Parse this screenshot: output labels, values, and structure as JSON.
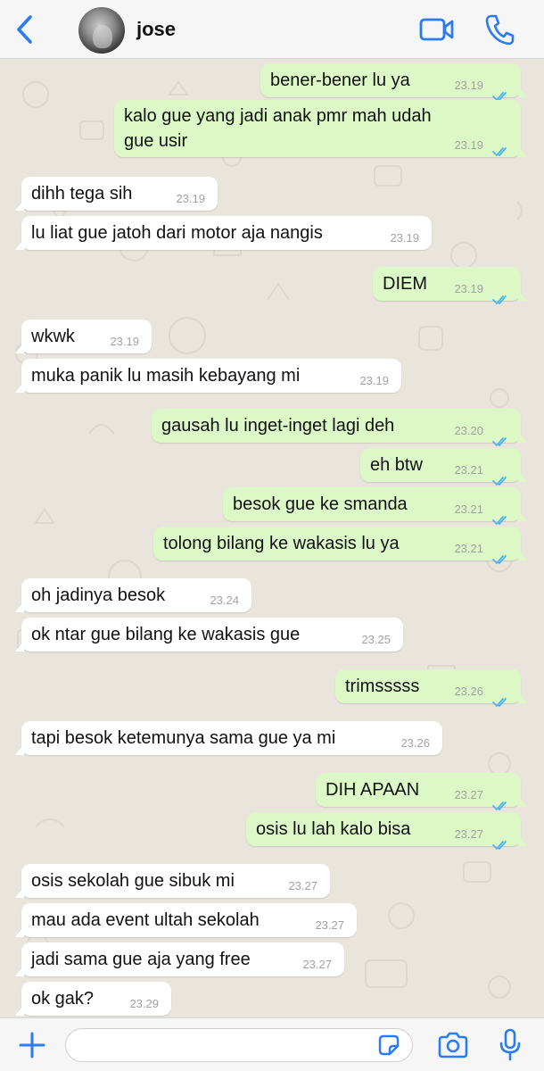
{
  "header": {
    "contact_name": "jose",
    "icons": [
      "chevron-left-icon",
      "video-camera-icon",
      "phone-icon"
    ]
  },
  "colors": {
    "accent": "#2a7bf6",
    "incoming_bubble": "#ffffff",
    "outgoing_bubble": "#dcf8c6",
    "read_ticks": "#4fb6ec",
    "timestamp": "#a2a2a2"
  },
  "messages": [
    {
      "dir": "out",
      "text": "bener-bener lu ya",
      "time": "23.19",
      "status": "read"
    },
    {
      "dir": "out",
      "text": "kalo gue yang jadi anak pmr mah udah gue usir",
      "time": "23.19",
      "status": "read"
    },
    {
      "dir": "in",
      "text": "dihh tega sih",
      "time": "23.19"
    },
    {
      "dir": "in",
      "text": "lu liat gue jatoh dari motor aja nangis",
      "time": "23.19"
    },
    {
      "dir": "out",
      "text": "DIEM",
      "time": "23.19",
      "status": "read"
    },
    {
      "dir": "in",
      "text": "wkwk",
      "time": "23.19"
    },
    {
      "dir": "in",
      "text": "muka panik lu masih kebayang mi",
      "time": "23.19"
    },
    {
      "dir": "out",
      "text": "gausah lu inget-inget lagi deh",
      "time": "23.20",
      "status": "read"
    },
    {
      "dir": "out",
      "text": "eh btw",
      "time": "23.21",
      "status": "read"
    },
    {
      "dir": "out",
      "text": "besok gue ke smanda",
      "time": "23.21",
      "status": "read"
    },
    {
      "dir": "out",
      "text": "tolong bilang ke wakasis lu ya",
      "time": "23.21",
      "status": "read"
    },
    {
      "dir": "in",
      "text": "oh jadinya besok",
      "time": "23.24"
    },
    {
      "dir": "in",
      "text": "ok ntar gue bilang ke wakasis gue",
      "time": "23.25"
    },
    {
      "dir": "out",
      "text": "trimsssss",
      "time": "23.26",
      "status": "read"
    },
    {
      "dir": "in",
      "text": "tapi besok ketemunya sama gue ya mi",
      "time": "23.26"
    },
    {
      "dir": "out",
      "text": "DIH APAAN",
      "time": "23.27",
      "status": "read"
    },
    {
      "dir": "out",
      "text": "osis lu lah kalo bisa",
      "time": "23.27",
      "status": "read"
    },
    {
      "dir": "in",
      "text": "osis sekolah gue sibuk mi",
      "time": "23.27"
    },
    {
      "dir": "in",
      "text": "mau ada event ultah sekolah",
      "time": "23.27"
    },
    {
      "dir": "in",
      "text": "jadi sama gue aja yang free",
      "time": "23.27"
    },
    {
      "dir": "in",
      "text": "ok gak?",
      "time": "23.29"
    }
  ],
  "input_bar": {
    "placeholder": "",
    "value": "",
    "icons": [
      "plus-icon",
      "sticker-icon",
      "camera-icon",
      "microphone-icon"
    ]
  }
}
